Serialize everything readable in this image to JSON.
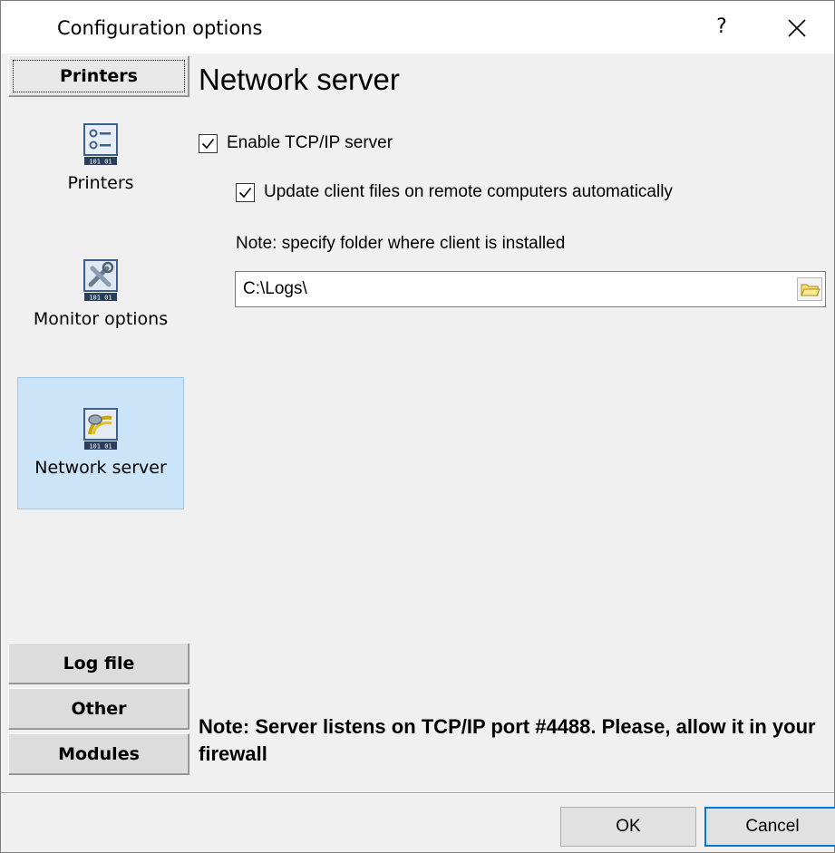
{
  "window": {
    "title": "Configuration options",
    "help_label": "?",
    "close_icon": "close-icon"
  },
  "sidebar": {
    "groups": {
      "printers": "Printers",
      "log_file": "Log file",
      "other": "Other",
      "modules": "Modules"
    },
    "items": [
      {
        "label": "Printers",
        "icon": "printer-list-icon",
        "selected": false
      },
      {
        "label": "Monitor options",
        "icon": "tools-icon",
        "selected": true
      },
      {
        "label": "Network server",
        "icon": "network-plug-icon",
        "selected": true
      }
    ]
  },
  "content": {
    "title": "Network server",
    "enable_tcp": {
      "label": "Enable TCP/IP server",
      "checked": true
    },
    "update_client": {
      "label": "Update client files on remote computers automatically",
      "checked": true
    },
    "folder_note": "Note: specify folder where client is installed",
    "folder_path": "C:\\Logs\\",
    "folder_button_icon": "folder-icon",
    "firewall_note": "Note: Server listens on TCP/IP port #4488. Please, allow it in your firewall"
  },
  "buttons": {
    "ok": "OK",
    "cancel": "Cancel"
  },
  "colors": {
    "selection_bg": "#cce4f7",
    "selection_border": "#99c9ef",
    "default_button_border": "#0078d7"
  }
}
